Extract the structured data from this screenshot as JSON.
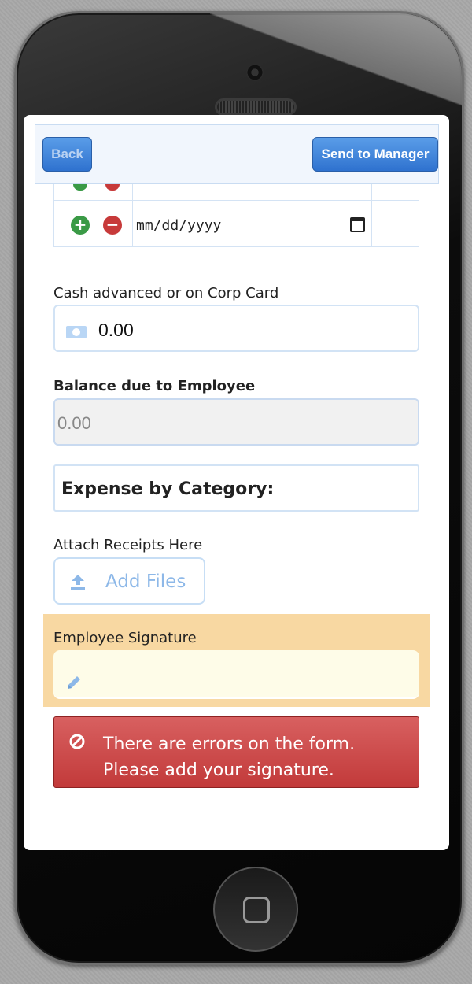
{
  "toolbar": {
    "back_label": "Back",
    "send_label": "Send to Manager"
  },
  "expense_row": {
    "date_placeholder": "mm/dd/yyyy"
  },
  "cash_advanced": {
    "label": "Cash advanced or on Corp Card",
    "value": "0.00"
  },
  "balance_due": {
    "label": "Balance due to Employee",
    "value": "0.00"
  },
  "category": {
    "heading": "Expense by Category:"
  },
  "receipts": {
    "label": "Attach Receipts Here",
    "button_label": "Add Files"
  },
  "signature": {
    "label": "Employee Signature"
  },
  "error": {
    "line1": "There are errors on the form.",
    "line2": "Please add your signature."
  },
  "colors": {
    "accent_blue": "#2f72cf",
    "error_red": "#c23a3a",
    "signature_highlight": "#f8d8a2",
    "add_green": "#3a9a46",
    "remove_red": "#c73a3a"
  },
  "icons": {
    "add_row": "plus-circle-icon",
    "remove_row": "minus-circle-icon",
    "calendar": "calendar-icon",
    "money": "money-icon",
    "upload": "upload-icon",
    "signature": "pencil-icon",
    "error": "ban-icon"
  }
}
